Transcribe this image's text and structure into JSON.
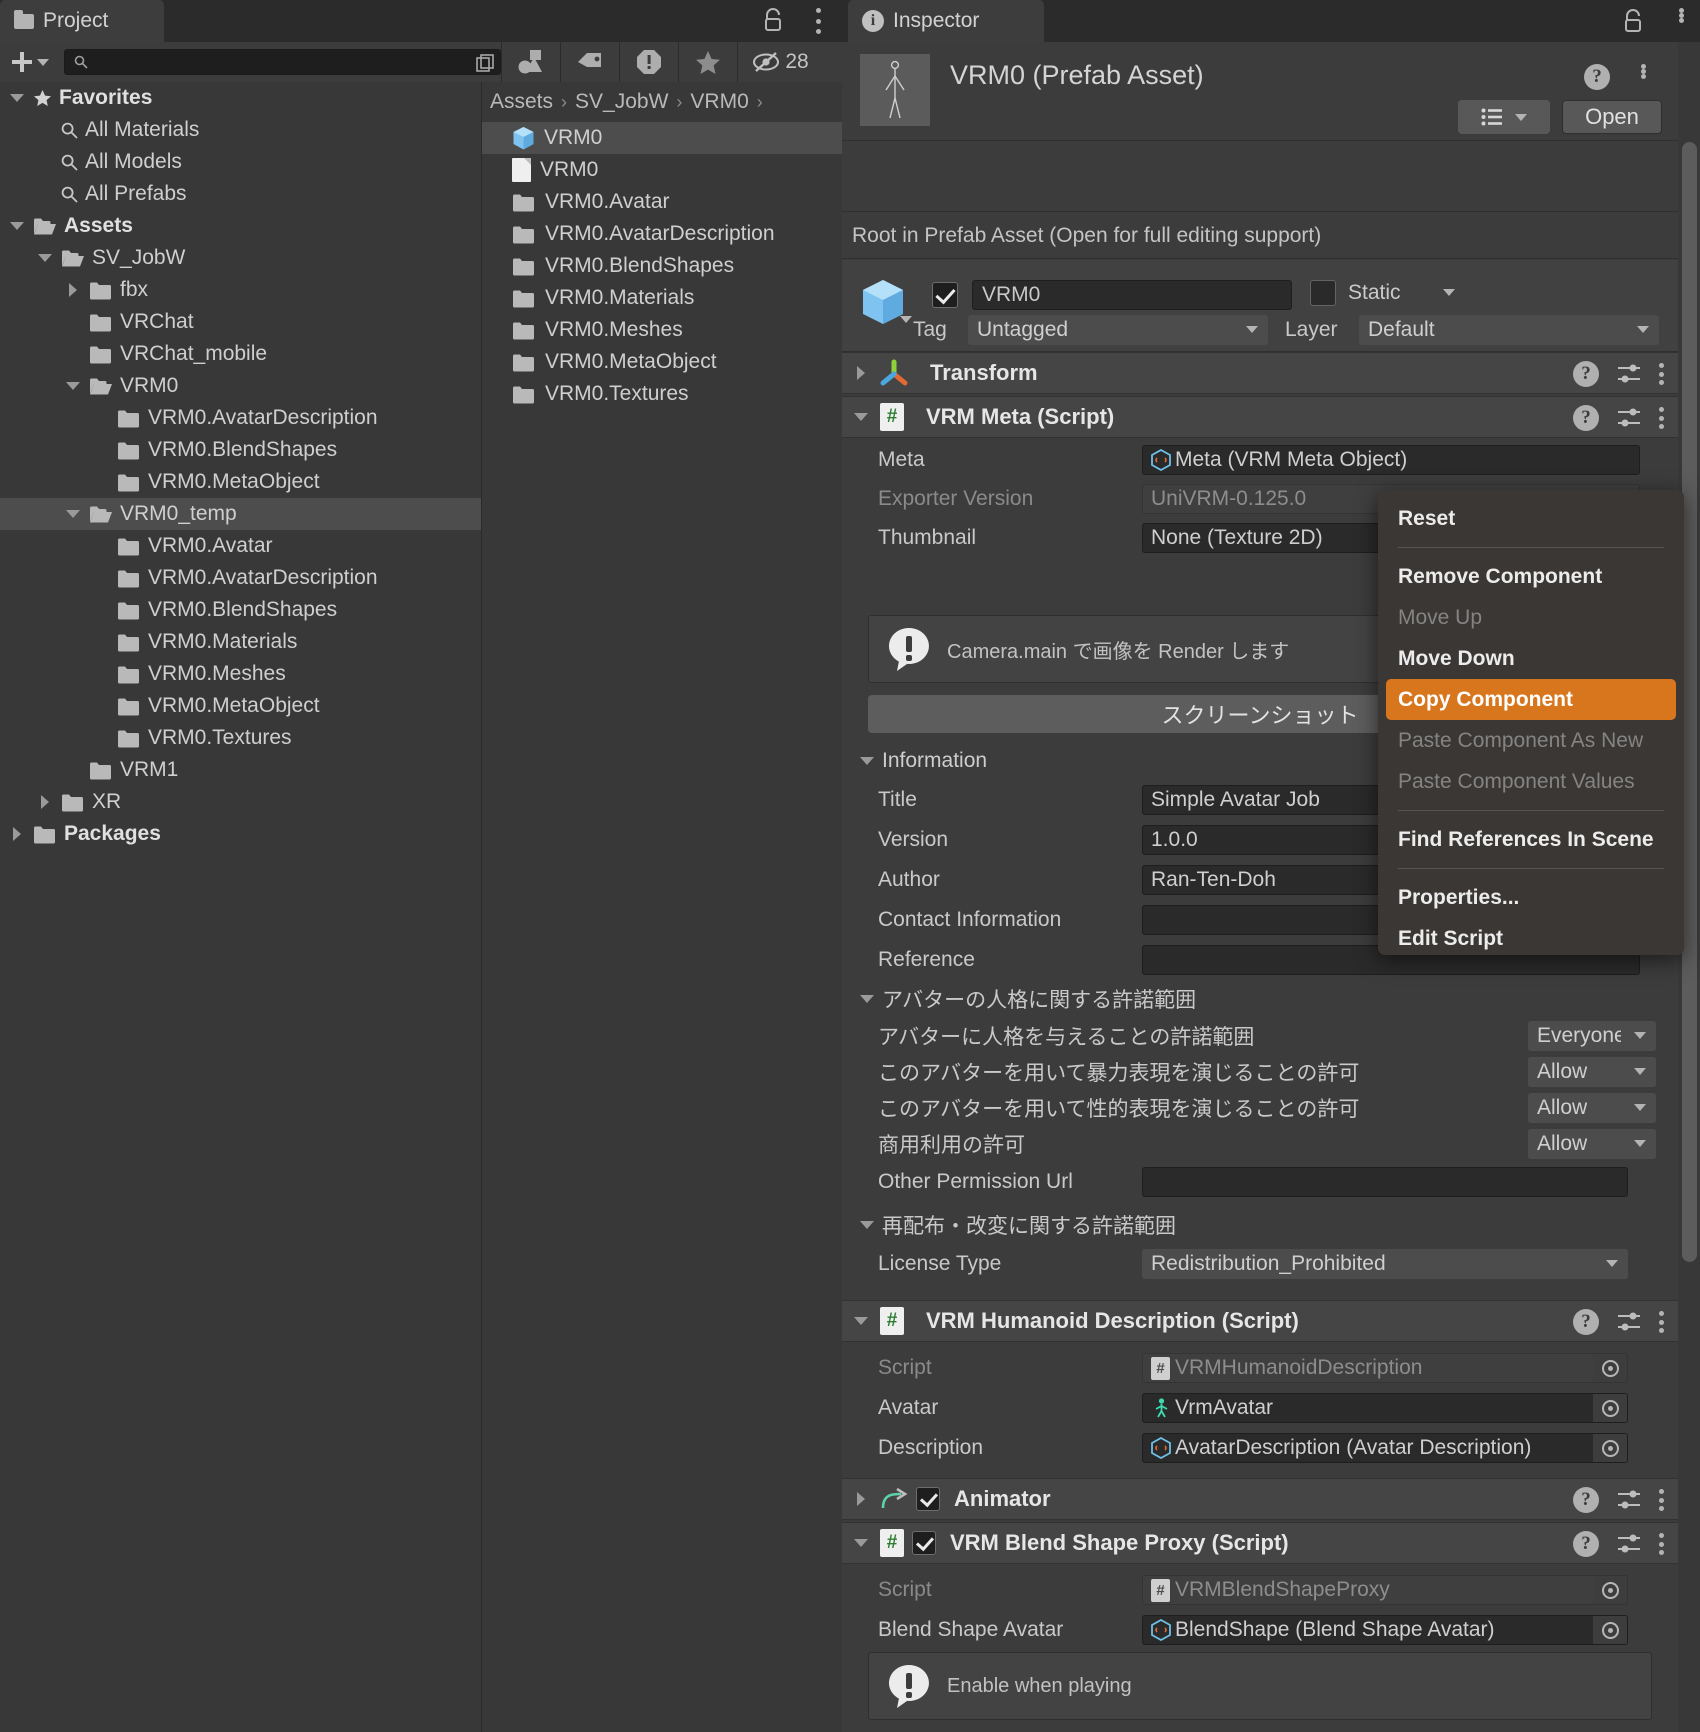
{
  "project": {
    "tab_label": "Project",
    "toolbar": {
      "add_label": "+",
      "search_placeholder": "",
      "search_value": "",
      "hidden_count": "28",
      "icons": [
        "add-dropdown",
        "search-icon",
        "expand-search-icon",
        "asset-filter-icon",
        "label-filter-icon",
        "warning-filter-icon",
        "favorite-filter-icon",
        "hidden-count-icon"
      ]
    },
    "tree": [
      {
        "label": "Favorites",
        "depth": 0,
        "arrow": "down",
        "icon": "star-icon",
        "bold": true
      },
      {
        "label": "All Materials",
        "depth": 1,
        "arrow": "none",
        "icon": "search-icon",
        "bold": false
      },
      {
        "label": "All Models",
        "depth": 1,
        "arrow": "none",
        "icon": "search-icon",
        "bold": false
      },
      {
        "label": "All Prefabs",
        "depth": 1,
        "arrow": "none",
        "icon": "search-icon",
        "bold": false
      },
      {
        "label": "Assets",
        "depth": 0,
        "arrow": "down",
        "icon": "folder-open-icon",
        "bold": true
      },
      {
        "label": "SV_JobW",
        "depth": 1,
        "arrow": "down",
        "icon": "folder-open-icon",
        "bold": false
      },
      {
        "label": "fbx",
        "depth": 2,
        "arrow": "right",
        "icon": "folder-icon",
        "bold": false
      },
      {
        "label": "VRChat",
        "depth": 2,
        "arrow": "none",
        "icon": "folder-icon",
        "bold": false
      },
      {
        "label": "VRChat_mobile",
        "depth": 2,
        "arrow": "none",
        "icon": "folder-icon",
        "bold": false
      },
      {
        "label": "VRM0",
        "depth": 2,
        "arrow": "down",
        "icon": "folder-open-icon",
        "bold": false
      },
      {
        "label": "VRM0.AvatarDescription",
        "depth": 3,
        "arrow": "none",
        "icon": "folder-icon",
        "bold": false
      },
      {
        "label": "VRM0.BlendShapes",
        "depth": 3,
        "arrow": "none",
        "icon": "folder-icon",
        "bold": false
      },
      {
        "label": "VRM0.MetaObject",
        "depth": 3,
        "arrow": "none",
        "icon": "folder-icon",
        "bold": false
      },
      {
        "label": "VRM0_temp",
        "depth": 2,
        "arrow": "down",
        "icon": "folder-open-icon",
        "bold": false,
        "selected": true
      },
      {
        "label": "VRM0.Avatar",
        "depth": 3,
        "arrow": "none",
        "icon": "folder-icon",
        "bold": false
      },
      {
        "label": "VRM0.AvatarDescription",
        "depth": 3,
        "arrow": "none",
        "icon": "folder-icon",
        "bold": false
      },
      {
        "label": "VRM0.BlendShapes",
        "depth": 3,
        "arrow": "none",
        "icon": "folder-icon",
        "bold": false
      },
      {
        "label": "VRM0.Materials",
        "depth": 3,
        "arrow": "none",
        "icon": "folder-icon",
        "bold": false
      },
      {
        "label": "VRM0.Meshes",
        "depth": 3,
        "arrow": "none",
        "icon": "folder-icon",
        "bold": false
      },
      {
        "label": "VRM0.MetaObject",
        "depth": 3,
        "arrow": "none",
        "icon": "folder-icon",
        "bold": false
      },
      {
        "label": "VRM0.Textures",
        "depth": 3,
        "arrow": "none",
        "icon": "folder-icon",
        "bold": false
      },
      {
        "label": "VRM1",
        "depth": 2,
        "arrow": "none",
        "icon": "folder-icon",
        "bold": false
      },
      {
        "label": "XR",
        "depth": 1,
        "arrow": "right",
        "icon": "folder-icon",
        "bold": false
      },
      {
        "label": "Packages",
        "depth": 0,
        "arrow": "right",
        "icon": "folder-icon",
        "bold": true
      }
    ],
    "breadcrumb": [
      "Assets",
      "SV_JobW",
      "VRM0"
    ],
    "files": [
      {
        "label": "VRM0",
        "icon": "prefab-cube-icon",
        "selected": true
      },
      {
        "label": "VRM0",
        "icon": "file-icon",
        "selected": false
      },
      {
        "label": "VRM0.Avatar",
        "icon": "folder-icon",
        "selected": false
      },
      {
        "label": "VRM0.AvatarDescription",
        "icon": "folder-icon",
        "selected": false
      },
      {
        "label": "VRM0.BlendShapes",
        "icon": "folder-icon",
        "selected": false
      },
      {
        "label": "VRM0.Materials",
        "icon": "folder-icon",
        "selected": false
      },
      {
        "label": "VRM0.Meshes",
        "icon": "folder-icon",
        "selected": false
      },
      {
        "label": "VRM0.MetaObject",
        "icon": "folder-icon",
        "selected": false
      },
      {
        "label": "VRM0.Textures",
        "icon": "folder-icon",
        "selected": false
      }
    ]
  },
  "inspector": {
    "tab_label": "Inspector",
    "asset_title": "VRM0 (Prefab Asset)",
    "listview_icon": "list-view-icon",
    "open_label": "Open",
    "prefab_note": "Root in Prefab Asset (Open for full editing support)",
    "gameobject": {
      "name": "VRM0",
      "static_label": "Static",
      "tag_label": "Tag",
      "tag_value": "Untagged",
      "layer_label": "Layer",
      "layer_value": "Default"
    },
    "components": {
      "transform": {
        "title": "Transform",
        "folded": true
      },
      "vrm_meta": {
        "title": "VRM Meta (Script)",
        "meta_label": "Meta",
        "meta_value": "Meta (VRM Meta Object)",
        "exporter_label": "Exporter Version",
        "exporter_value": "UniVRM-0.125.0",
        "thumbnail_label": "Thumbnail",
        "thumbnail_value": "None (Texture 2D)",
        "helpbox": "Camera.main で画像を Render します",
        "screenshot_button": "スクリーンショット",
        "information_label": "Information",
        "title_label": "Title",
        "title_value": "Simple Avatar Job",
        "version_label": "Version",
        "version_value": "1.0.0",
        "author_label": "Author",
        "author_value": "Ran-Ten-Doh",
        "contact_label": "Contact Information",
        "contact_value": "",
        "reference_label": "Reference",
        "reference_value": "",
        "personality_group": "アバターの人格に関する許諾範囲",
        "permissions": [
          {
            "label": "アバターに人格を与えることの許諾範囲",
            "value": "Everyone"
          },
          {
            "label": "このアバターを用いて暴力表現を演じることの許可",
            "value": "Allow"
          },
          {
            "label": "このアバターを用いて性的表現を演じることの許可",
            "value": "Allow"
          },
          {
            "label": "商用利用の許可",
            "value": "Allow"
          }
        ],
        "other_permission_label": "Other Permission Url",
        "other_permission_value": "",
        "redistribution_group": "再配布・改変に関する許諾範囲",
        "license_type_label": "License Type",
        "license_type_value": "Redistribution_Prohibited"
      },
      "vrm_humanoid": {
        "title": "VRM Humanoid Description (Script)",
        "script_label": "Script",
        "script_value": "VRMHumanoidDescription",
        "avatar_label": "Avatar",
        "avatar_value": "VrmAvatar",
        "description_label": "Description",
        "description_value": "AvatarDescription (Avatar Description)"
      },
      "animator": {
        "title": "Animator",
        "folded": true,
        "enabled": true
      },
      "vrm_blendshape_proxy": {
        "title": "VRM Blend Shape Proxy (Script)",
        "enabled": true,
        "script_label": "Script",
        "script_value": "VRMBlendShapeProxy",
        "blend_shape_avatar_label": "Blend Shape Avatar",
        "blend_shape_avatar_value": "BlendShape (Blend Shape Avatar)",
        "helpbox": "Enable when playing"
      }
    }
  },
  "context_menu": {
    "items": [
      {
        "label": "Reset",
        "state": "normal"
      },
      {
        "label": "__sep__",
        "state": "separator"
      },
      {
        "label": "Remove Component",
        "state": "normal"
      },
      {
        "label": "Move Up",
        "state": "disabled"
      },
      {
        "label": "Move Down",
        "state": "normal"
      },
      {
        "label": "Copy Component",
        "state": "highlighted"
      },
      {
        "label": "Paste Component As New",
        "state": "disabled"
      },
      {
        "label": "Paste Component Values",
        "state": "disabled"
      },
      {
        "label": "__sep__",
        "state": "separator"
      },
      {
        "label": "Find References In Scene",
        "state": "normal"
      },
      {
        "label": "__sep__",
        "state": "separator"
      },
      {
        "label": "Properties...",
        "state": "normal"
      },
      {
        "label": "Edit Script",
        "state": "normal"
      }
    ],
    "highlight_color": "#d8761e"
  },
  "colors": {
    "window_bg": "#383838",
    "panel_bg": "#3c3c3c",
    "header_bg": "#454545",
    "field_bg": "#2a2a2a",
    "accent_orange": "#d8761e",
    "selection": "#4d4d4d"
  }
}
